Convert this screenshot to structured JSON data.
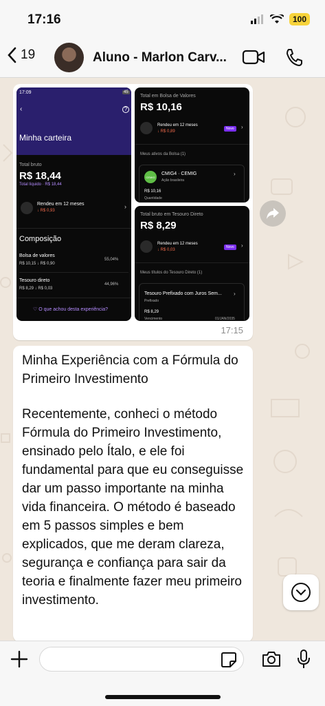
{
  "status_bar": {
    "time": "17:16",
    "battery": "100"
  },
  "header": {
    "back_count": "19",
    "contact_name": "Aluno - Marlon Carv..."
  },
  "image_message": {
    "time": "17:15",
    "screen1": {
      "clock": "17:09",
      "battery": "45",
      "title": "Minha carteira",
      "total_label": "Total bruto",
      "total_value": "R$ 18,44",
      "liquid": "Total líquido · R$ 18,44",
      "rendeu": "Rendeu em 12 meses",
      "rendeu_value": "↓ R$ 0,93",
      "composition": "Composição",
      "bolsa_label": "Bolsa de valores",
      "bolsa_values": "R$ 10,15 ↓ R$ 0,90",
      "bolsa_pct": "55,04%",
      "tesouro_label": "Tesouro direto",
      "tesouro_values": "R$ 8,29 ↓ R$ 0,03",
      "tesouro_pct": "44,96%",
      "feedback": "♡ O que achou desta experiência?"
    },
    "screen2": {
      "label": "Total em Bolsa de Valores",
      "value": "R$ 10,16",
      "rendeu": "Rendeu em 12 meses",
      "rendeu_value": "↓ R$ 0,89",
      "badge": "Novo",
      "assets": "Meus ativos da Bolsa (1)",
      "ticker": "CMIG4 · CEMIG",
      "ticker_sub": "Ação brasileira",
      "ticker_value": "R$ 10,16",
      "ticker_extra": "Quantidade"
    },
    "screen3": {
      "label": "Total bruto em Tesouro Direto",
      "value": "R$ 8,29",
      "rendeu": "Rendeu em 12 meses",
      "rendeu_value": "↓ R$ 0,03",
      "badge": "Novo",
      "titles": "Meus títulos do Tesouro Direto (1)",
      "bond": "Tesouro Prefixado com Juros Sem...",
      "bond_sub": "Prefixado",
      "bond_value": "R$ 8,29",
      "bond_extra": "Vencimento",
      "bond_date": "01/JAN/2035"
    }
  },
  "text_message": {
    "title": "Minha Experiência com a Fórmula do Primeiro Investimento",
    "body": "Recentemente, conheci o método Fórmula do Primeiro Investimento, ensinado pelo Ítalo, e ele foi fundamental para que eu conseguisse dar um passo importante na minha vida financeira. O método é baseado em 5 passos simples e bem explicados, que me deram clareza, segurança e confiança para sair da teoria e finalmente fazer meu primeiro investimento."
  },
  "icons": [
    "back-chevron-icon",
    "video-camera-icon",
    "phone-icon",
    "forward-icon",
    "chevron-down-icon",
    "plus-icon",
    "sticker-icon",
    "camera-icon",
    "microphone-icon"
  ],
  "colors": {
    "wallpaper": "#efe7dd",
    "bubble": "#ffffff",
    "app_purple": "#2a1f6d",
    "negative": "#f36b4c",
    "badge": "#7b2ff2"
  }
}
